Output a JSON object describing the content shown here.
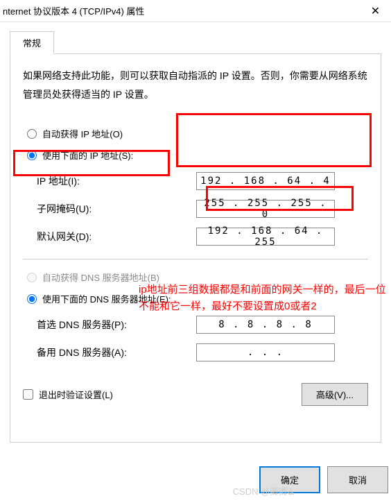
{
  "titlebar": {
    "title": "nternet 协议版本 4 (TCP/IPv4) 属性",
    "close": "✕"
  },
  "tabs": {
    "general": "常规"
  },
  "description": "如果网络支持此功能，则可以获取自动指派的 IP 设置。否则，你需要从网络系统管理员处获得适当的 IP 设置。",
  "ip_section": {
    "auto_label": "自动获得 IP 地址(O)",
    "manual_label": "使用下面的 IP 地址(S):",
    "ip_label": "IP 地址(I):",
    "ip_value": "192 . 168 .  64  .   4",
    "mask_label": "子网掩码(U):",
    "mask_value": "255 . 255 . 255 .   0",
    "gateway_label": "默认网关(D):",
    "gateway_value": "192 . 168 .  64  . 255"
  },
  "dns_section": {
    "auto_label": "自动获得 DNS 服务器地址(B)",
    "manual_label": "使用下面的 DNS 服务器地址(E):",
    "primary_label": "首选 DNS 服务器(P):",
    "primary_value": "8  .   8  .   8  .   8",
    "alt_label": "备用 DNS 服务器(A):",
    "alt_value": ".       .       ."
  },
  "validate_on_exit": "退出时验证设置(L)",
  "advanced_button": "高级(V)...",
  "buttons": {
    "ok": "确定",
    "cancel": "取消"
  },
  "annotation": "ip地址前三组数据都是和前面的网关一样的，最后一位不能和它一样，最好不要设置成0或者2",
  "watermark": "CSDN @卿卿&"
}
